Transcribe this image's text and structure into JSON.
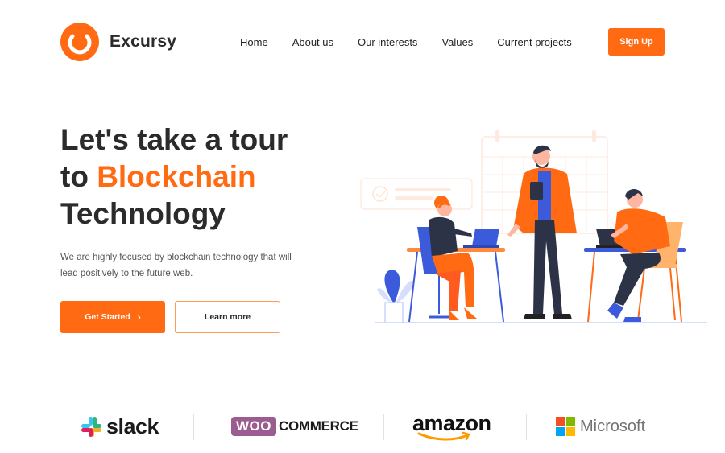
{
  "brand": {
    "name": "Excursy"
  },
  "nav": {
    "items": [
      {
        "label": "Home"
      },
      {
        "label": "About us"
      },
      {
        "label": "Our interests"
      },
      {
        "label": "Values"
      },
      {
        "label": "Current projects"
      }
    ],
    "signup_label": "Sign Up"
  },
  "hero": {
    "title_line1": "Let's take a tour",
    "title_line2_prefix": "to ",
    "title_line2_accent": "Blockchain",
    "title_line3": "Technology",
    "description": "We are highly focused by blockchain technology that will lead positively to the future web.",
    "primary_cta": "Get Started",
    "primary_cta_icon": "chevron-right-icon",
    "secondary_cta": "Learn more"
  },
  "partners": {
    "logos": [
      {
        "name": "slack",
        "label": "slack"
      },
      {
        "name": "woocommerce",
        "box": "WOO",
        "rest": "COMMERCE"
      },
      {
        "name": "amazon",
        "label": "amazon"
      },
      {
        "name": "microsoft",
        "label": "Microsoft"
      }
    ]
  },
  "colors": {
    "accent": "#ff6a13",
    "text": "#2b2b2b",
    "woo_purple": "#9b5c8f",
    "illustration_blue": "#3b5bdb"
  }
}
